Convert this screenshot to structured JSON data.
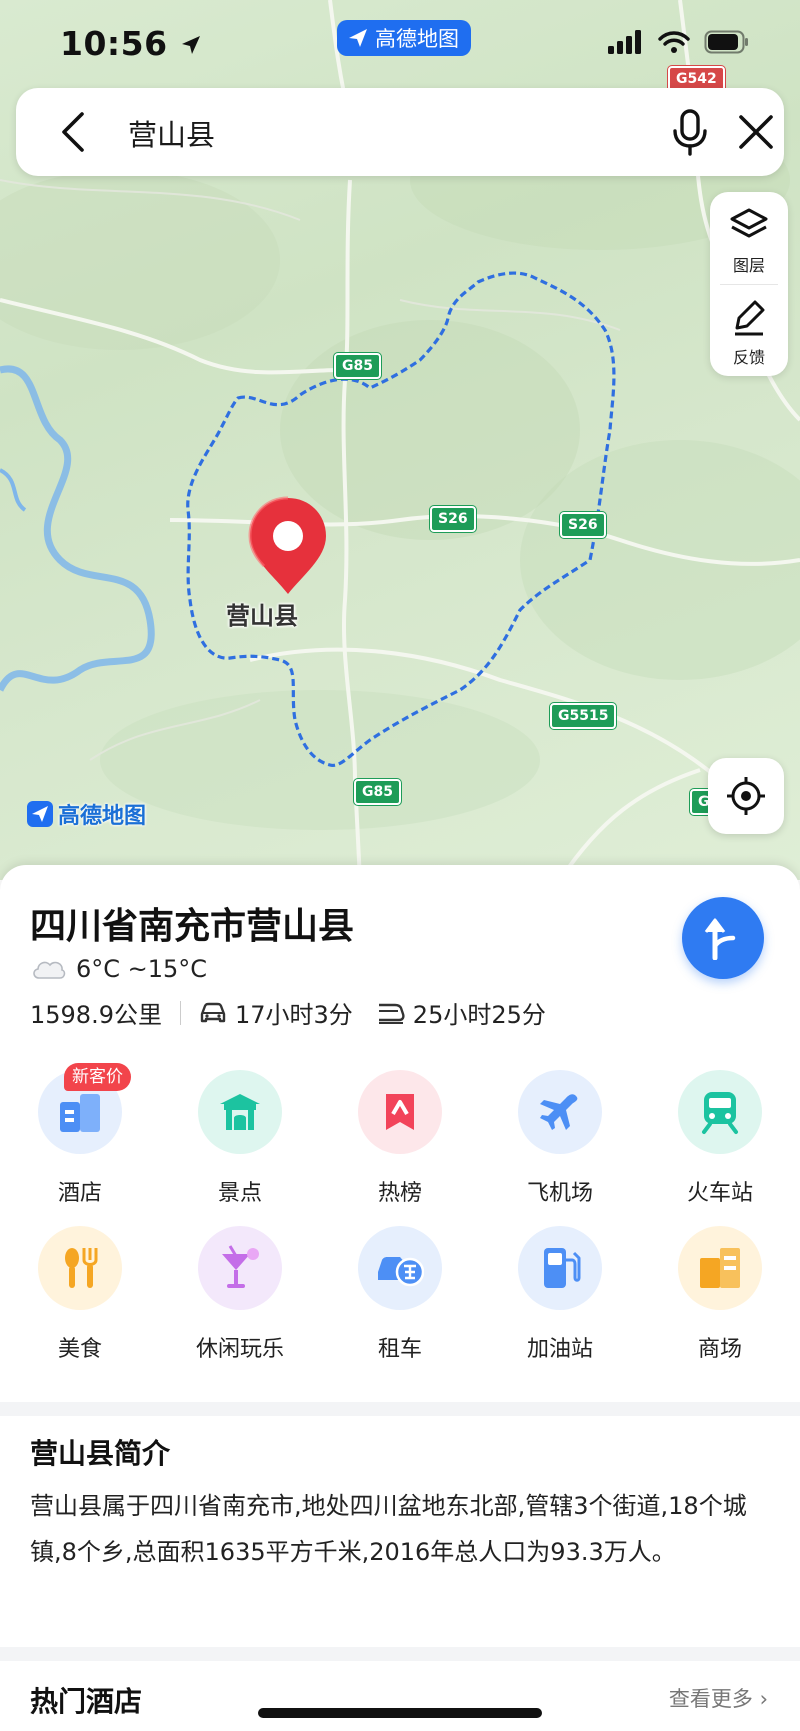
{
  "status_bar": {
    "time": "10:56",
    "app_pill": "高德地图"
  },
  "search": {
    "query": "营山县"
  },
  "map": {
    "place_label": "营山县",
    "watermark": "高德地图",
    "road_shields": [
      {
        "text": "G542",
        "color": "red"
      },
      {
        "text": "G85",
        "color": "green"
      },
      {
        "text": "S26",
        "color": "green"
      },
      {
        "text": "S26",
        "color": "green"
      },
      {
        "text": "G5515",
        "color": "green"
      },
      {
        "text": "G85",
        "color": "green"
      },
      {
        "text": "G",
        "color": "green"
      }
    ],
    "tools": [
      {
        "label": "图层",
        "icon": "layers-icon"
      },
      {
        "label": "反馈",
        "icon": "feedback-edit-icon"
      }
    ],
    "colors": {
      "boundary": "#2f6fe0",
      "pin": "#e6313c",
      "road_shield": "#1e9c58"
    }
  },
  "place": {
    "title": "四川省南充市营山县",
    "weather": "6°C ~15°C",
    "distance": "1598.9公里",
    "drive_time": "17小时3分",
    "train_time": "25小时25分"
  },
  "categories": [
    {
      "label": "酒店",
      "icon": "hotel-icon",
      "bg": "#e6effd",
      "badge": "新客价"
    },
    {
      "label": "景点",
      "icon": "scenic-spot-icon",
      "bg": "#def6ef"
    },
    {
      "label": "热榜",
      "icon": "hot-list-icon",
      "bg": "#fde7ea"
    },
    {
      "label": "飞机场",
      "icon": "airport-icon",
      "bg": "#e6effd"
    },
    {
      "label": "火车站",
      "icon": "train-station-icon",
      "bg": "#def6ef"
    },
    {
      "label": "美食",
      "icon": "food-icon",
      "bg": "#fff3dc"
    },
    {
      "label": "休闲玩乐",
      "icon": "leisure-icon",
      "bg": "#f3e8fb"
    },
    {
      "label": "租车",
      "icon": "car-rental-icon",
      "bg": "#e6effd"
    },
    {
      "label": "加油站",
      "icon": "gas-station-icon",
      "bg": "#e6effd"
    },
    {
      "label": "商场",
      "icon": "mall-icon",
      "bg": "#fff3dc"
    }
  ],
  "intro": {
    "heading": "营山县简介",
    "text": "营山县属于四川省南充市,地处四川盆地东北部,管辖3个街道,18个城镇,8个乡,总面积1635平方千米,2016年总人口为93.3万人。"
  },
  "hotels": {
    "heading": "热门酒店",
    "more": "查看更多 ›"
  }
}
